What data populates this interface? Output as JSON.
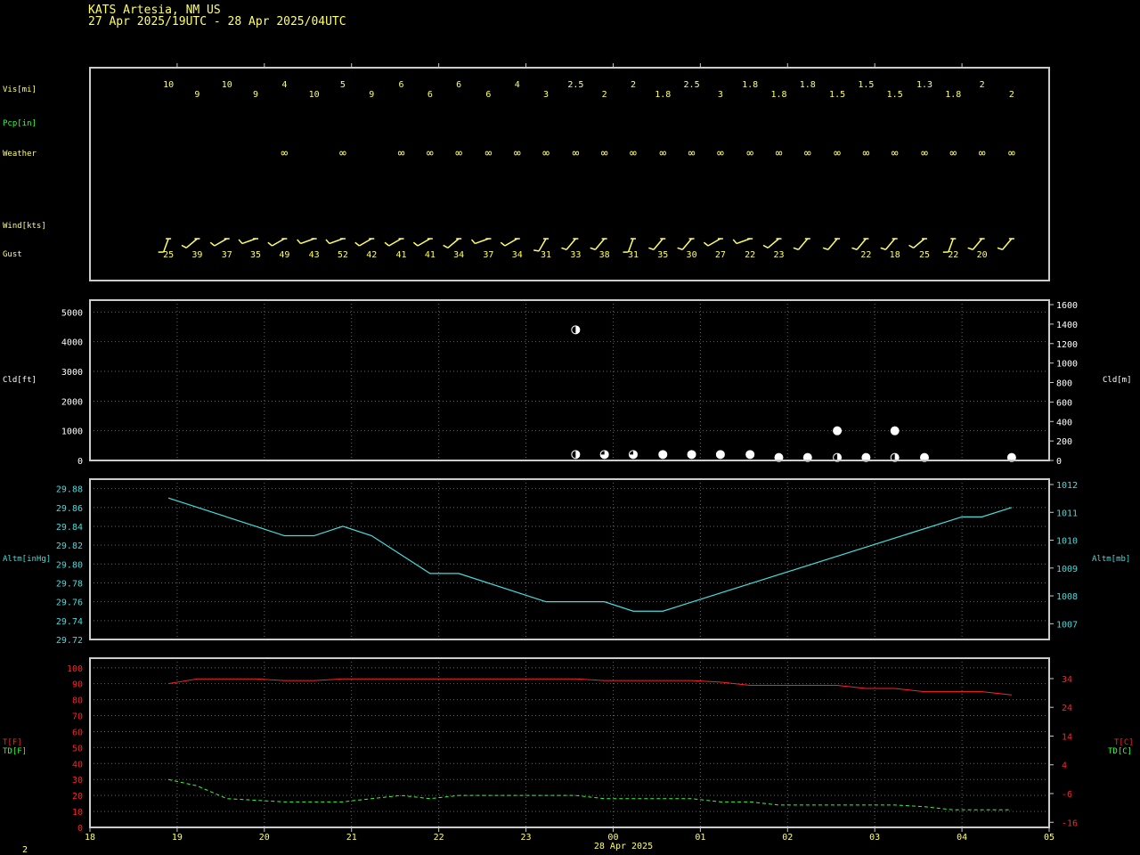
{
  "header": {
    "station": "KATS  Artesia, NM US",
    "period": "27 Apr 2025/19UTC - 28 Apr 2025/04UTC"
  },
  "footer": {
    "date_label": "28 Apr 2025",
    "page_number": "2"
  },
  "colors": {
    "yellow": "#ffff66",
    "green": "#33ff33",
    "white": "#ffffff",
    "cyan": "#44dddd",
    "red": "#ff2222",
    "frame": "#cccccc",
    "grid": "#666666"
  },
  "labels": {
    "vis": "Vis[mi]",
    "pcp": "Pcp[in]",
    "weather": "Weather",
    "wind": "Wind[kts]",
    "gust": "Gust",
    "cld_ft": "Cld[ft]",
    "cld_m": "Cld[m]",
    "altm_inhg": "Altm[inHg]",
    "altm_mb": "Altm[mb]",
    "t_f": "T[F]",
    "td_f": "TD[F]",
    "t_c": "T[C]",
    "td_c": "TD[C]"
  },
  "chart_data": [
    {
      "type": "table",
      "name": "surface observations",
      "x_axis": {
        "unit": "UTC hour",
        "range": [
          18,
          29
        ]
      },
      "obs_times": [
        18.9,
        19.23,
        19.57,
        19.9,
        20.23,
        20.57,
        20.9,
        21.23,
        21.57,
        21.9,
        22.23,
        22.57,
        22.9,
        23.23,
        23.57,
        23.9,
        24.23,
        24.57,
        24.9,
        25.23,
        25.57,
        25.9,
        26.23,
        26.57,
        26.9,
        27.23,
        27.57,
        27.9,
        28.23,
        28.57
      ],
      "visibility": [
        "10",
        "9",
        "10",
        "9",
        "4",
        "10",
        "5",
        "9",
        "6",
        "6",
        "6",
        "6",
        "4",
        "3",
        "2.5",
        "2",
        "2",
        "1.8",
        "2.5",
        "3",
        "1.8",
        "1.8",
        "1.8",
        "1.5",
        "1.5",
        "1.5",
        "1.3",
        "1.8",
        "2",
        "2"
      ],
      "weather_symbol": "∞",
      "weather_times": [
        20.23,
        20.9,
        21.57,
        21.9,
        22.23,
        22.57,
        22.9,
        23.23,
        23.57,
        23.9,
        24.23,
        24.57,
        24.9,
        25.23,
        25.57,
        25.9,
        26.23,
        26.57,
        26.9,
        27.23,
        27.57,
        27.9,
        28.23,
        28.57
      ],
      "wind_dir_deg": [
        200,
        230,
        240,
        250,
        240,
        250,
        250,
        240,
        240,
        240,
        230,
        250,
        240,
        210,
        220,
        220,
        200,
        220,
        220,
        240,
        250,
        230,
        220,
        220,
        220,
        220,
        230,
        200,
        220,
        220
      ],
      "gust_times": [
        18.9,
        19.23,
        19.57,
        19.9,
        20.23,
        20.57,
        20.9,
        21.23,
        21.57,
        21.9,
        22.23,
        22.57,
        22.9,
        23.23,
        23.57,
        23.9,
        24.23,
        24.57,
        24.9,
        25.23,
        25.57,
        25.9,
        26.9,
        27.23,
        27.57,
        27.9,
        28.23
      ],
      "gust_kts": [
        "25",
        "39",
        "37",
        "35",
        "49",
        "43",
        "52",
        "42",
        "41",
        "41",
        "34",
        "37",
        "34",
        "31",
        "33",
        "38",
        "31",
        "35",
        "30",
        "27",
        "22",
        "23",
        "22",
        "18",
        "25",
        "22",
        "20"
      ]
    },
    {
      "type": "scatter",
      "name": "cloud base",
      "ylim_ft": [
        0,
        5400
      ],
      "left_ticks": [
        "0",
        "1000",
        "2000",
        "3000",
        "4000",
        "5000"
      ],
      "right_ticks": [
        "0",
        "200",
        "400",
        "600",
        "800",
        "1000",
        "1200",
        "1400",
        "1600"
      ],
      "points": [
        {
          "x": 23.57,
          "ft": 4400,
          "cover": 0.5
        },
        {
          "x": 23.57,
          "ft": 200,
          "cover": 0.5
        },
        {
          "x": 23.9,
          "ft": 200,
          "cover": 0.75
        },
        {
          "x": 24.23,
          "ft": 200,
          "cover": 0.75
        },
        {
          "x": 24.57,
          "ft": 200,
          "cover": 1
        },
        {
          "x": 24.9,
          "ft": 200,
          "cover": 1
        },
        {
          "x": 25.23,
          "ft": 200,
          "cover": 1
        },
        {
          "x": 25.57,
          "ft": 200,
          "cover": 1
        },
        {
          "x": 25.9,
          "ft": 100,
          "cover": 1
        },
        {
          "x": 26.23,
          "ft": 100,
          "cover": 1
        },
        {
          "x": 26.57,
          "ft": 1000,
          "cover": 1
        },
        {
          "x": 26.57,
          "ft": 100,
          "cover": 0.5
        },
        {
          "x": 26.9,
          "ft": 100,
          "cover": 1
        },
        {
          "x": 27.23,
          "ft": 1000,
          "cover": 1
        },
        {
          "x": 27.23,
          "ft": 100,
          "cover": 0.5
        },
        {
          "x": 27.57,
          "ft": 100,
          "cover": 1
        },
        {
          "x": 28.57,
          "ft": 100,
          "cover": 1
        }
      ]
    },
    {
      "type": "line",
      "name": "altimeter",
      "ylim_inhg": [
        29.72,
        29.89
      ],
      "left_ticks": [
        "29.72",
        "29.74",
        "29.76",
        "29.78",
        "29.80",
        "29.82",
        "29.84",
        "29.86",
        "29.88"
      ],
      "right_ticks": [
        "1007",
        "1008",
        "1009",
        "1010",
        "1011",
        "1012"
      ],
      "x": [
        18.9,
        19.9,
        20.23,
        20.57,
        20.9,
        21.23,
        21.9,
        22.23,
        23.23,
        23.9,
        24.23,
        24.57,
        28.0,
        28.23,
        28.57
      ],
      "y": [
        29.87,
        29.84,
        29.83,
        29.83,
        29.84,
        29.83,
        29.79,
        29.79,
        29.76,
        29.76,
        29.75,
        29.75,
        29.85,
        29.85,
        29.86
      ]
    },
    {
      "type": "line",
      "name": "temperature and dew point",
      "ylim_f": [
        0,
        106
      ],
      "left_ticks": [
        "0",
        "10",
        "20",
        "30",
        "40",
        "50",
        "60",
        "70",
        "80",
        "90",
        "100"
      ],
      "right_ticks": [
        "-16",
        "-6",
        "4",
        "14",
        "24",
        "34"
      ],
      "x_tick_labels": [
        "18",
        "19",
        "20",
        "21",
        "22",
        "23",
        "00",
        "01",
        "02",
        "03",
        "04",
        "05"
      ],
      "series": [
        {
          "x": [
            18.9,
            19.23,
            19.57,
            19.9,
            20.23,
            20.57,
            20.9,
            21.23,
            21.57,
            21.9,
            22.23,
            22.57,
            22.9,
            23.23,
            23.57,
            23.9,
            24.23,
            24.57,
            24.9,
            25.23,
            25.57,
            25.9,
            26.23,
            26.57,
            26.9,
            27.23,
            27.57,
            27.9,
            28.23,
            28.57
          ],
          "values": [
            90,
            93,
            93,
            93,
            92,
            92,
            93,
            93,
            93,
            93,
            93,
            93,
            93,
            93,
            93,
            92,
            92,
            92,
            92,
            91,
            89,
            89,
            89,
            89,
            87,
            87,
            85,
            85,
            85,
            83
          ]
        },
        {
          "x": [
            18.9,
            19.23,
            19.57,
            19.9,
            20.23,
            20.57,
            20.9,
            21.23,
            21.57,
            21.9,
            22.23,
            22.57,
            22.9,
            23.23,
            23.57,
            23.9,
            24.23,
            24.57,
            24.9,
            25.23,
            25.57,
            25.9,
            26.23,
            26.57,
            26.9,
            27.23,
            27.57,
            27.9,
            28.23,
            28.57
          ],
          "values": [
            30,
            26,
            18,
            17,
            16,
            16,
            16,
            18,
            20,
            18,
            20,
            20,
            20,
            20,
            20,
            18,
            18,
            18,
            18,
            16,
            16,
            14,
            14,
            14,
            14,
            14,
            13,
            11,
            11,
            11
          ]
        }
      ]
    }
  ]
}
